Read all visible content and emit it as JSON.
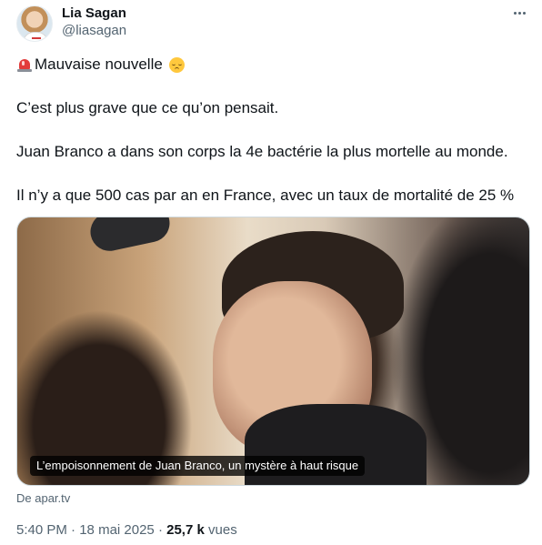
{
  "author": {
    "name": "Lia Sagan",
    "handle": "@liasagan"
  },
  "icons": {
    "more": "more-options-icon",
    "siren": "rotating-light-emoji",
    "face": "disappointed-face-emoji"
  },
  "tweet": {
    "line1": "Mauvaise nouvelle",
    "line2": "C’est plus grave que ce qu’on pensait.",
    "line3": "Juan Branco a dans son corps la 4e bactérie la plus mortelle au monde.",
    "line4": "Il n’y a que 500 cas par an en France, avec un taux de mortalité de 25 %"
  },
  "card": {
    "caption": "L’empoisonnement de Juan Branco, un mystère à haut risque",
    "source": "De apar.tv"
  },
  "meta": {
    "time": "5:40 PM",
    "separator1": " · ",
    "date": "18 mai 2025",
    "separator2": " · ",
    "views_count": "25,7 k",
    "views_label": " vues"
  }
}
